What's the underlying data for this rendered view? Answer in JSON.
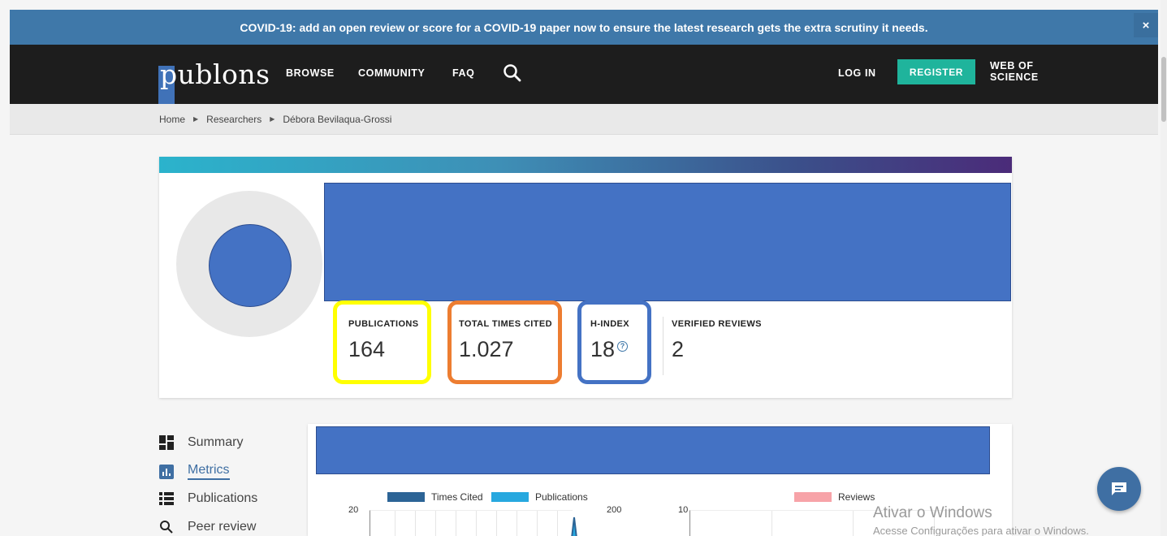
{
  "banner": {
    "text": "COVID-19: add an open review or score for a COVID-19 paper now to ensure the latest research gets the extra scrutiny it needs.",
    "close_label": "×"
  },
  "nav": {
    "logo_text": "publons",
    "browse": "BROWSE",
    "community": "COMMUNITY",
    "faq": "FAQ",
    "login": "LOG IN",
    "register": "REGISTER",
    "web_of_science_line1": "WEB OF",
    "web_of_science_line2": "SCIENCE"
  },
  "breadcrumb": {
    "home": "Home",
    "researchers": "Researchers",
    "current": "Débora Bevilaqua-Grossi"
  },
  "profile": {
    "metrics": [
      {
        "label": "PUBLICATIONS",
        "value": "164",
        "highlight": "#ffff00"
      },
      {
        "label": "TOTAL TIMES CITED",
        "value": "1.027",
        "highlight": "#ed7d31"
      },
      {
        "label": "H-INDEX",
        "value": "18",
        "highlight": "#4472c4"
      },
      {
        "label": "VERIFIED REVIEWS",
        "value": "2"
      }
    ],
    "help_icon": "?"
  },
  "side_nav": [
    {
      "label": "Summary",
      "icon": "summary-icon"
    },
    {
      "label": "Metrics",
      "icon": "metrics-icon",
      "active": true
    },
    {
      "label": "Publications",
      "icon": "publications-icon"
    },
    {
      "label": "Peer review",
      "icon": "peer-review-icon"
    }
  ],
  "chart": {
    "legend": [
      "Times Cited",
      "Publications",
      "Reviews"
    ],
    "colors": {
      "times_cited": "#2c6496",
      "publications": "#27a8df",
      "reviews": "#f7a3a8"
    },
    "left_axis_top": "20",
    "mid_axis_top": "200",
    "right_axis_top": "10"
  },
  "watermark": {
    "line1": "Ativar o Windows",
    "line2": "Acesse Configurações para ativar o Windows."
  },
  "colors": {
    "banner": "#3f78a9",
    "navbar": "#1d1d1d",
    "register": "#1fb49c",
    "redaction": "#4472c4"
  }
}
